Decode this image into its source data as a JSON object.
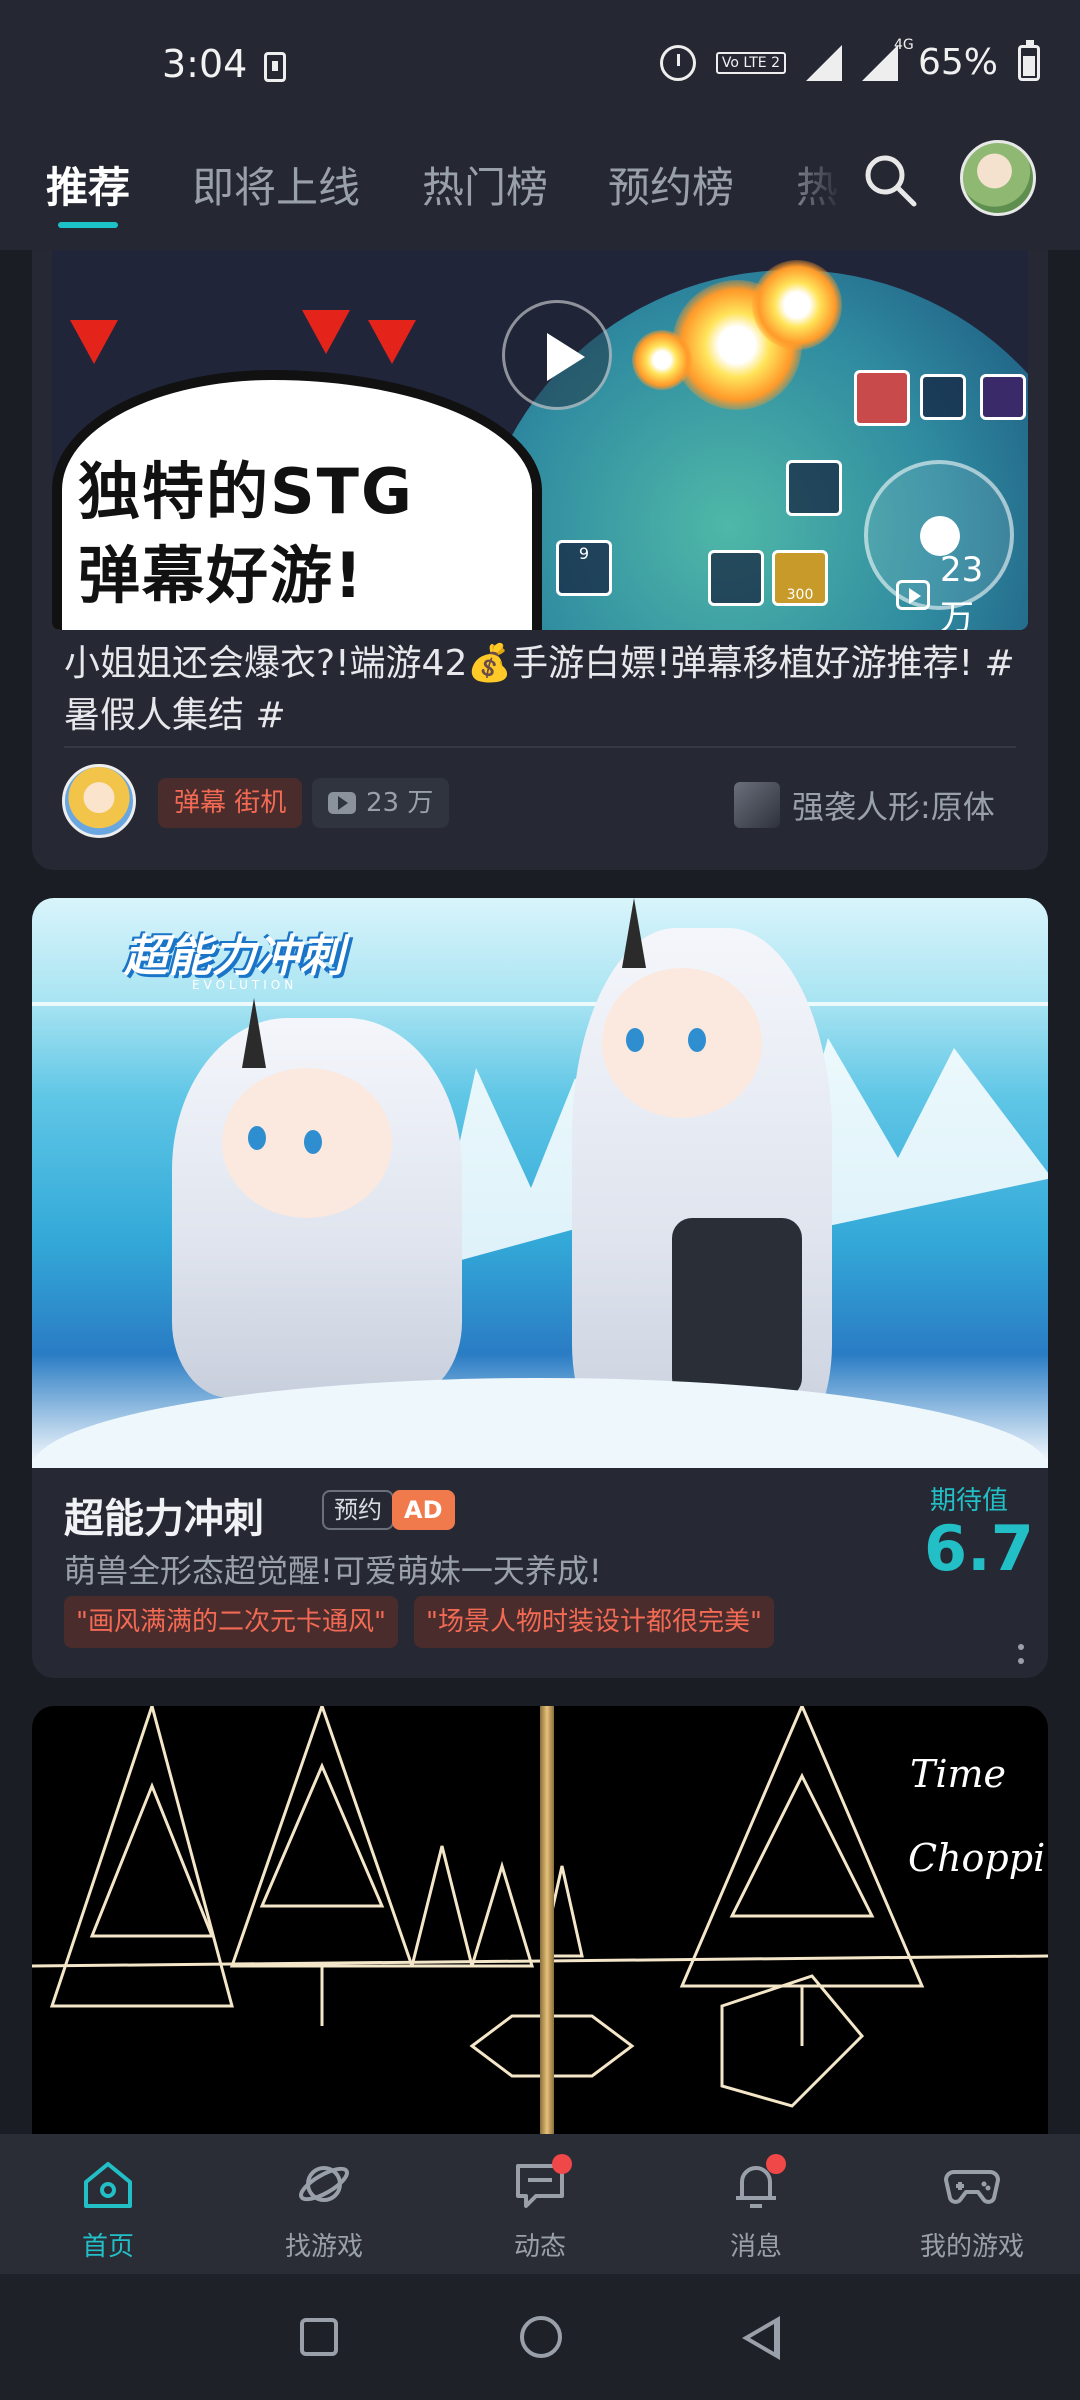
{
  "status_bar": {
    "time": "3:04",
    "volte_label": "Vo LTE 2",
    "network_label": "4G",
    "battery": "65%"
  },
  "top_tabs": [
    {
      "label": "推荐",
      "active": true
    },
    {
      "label": "即将上线",
      "active": false
    },
    {
      "label": "热门榜",
      "active": false
    },
    {
      "label": "预约榜",
      "active": false
    },
    {
      "label": "热",
      "active": false
    }
  ],
  "card1": {
    "banner_caption": "独特的STG\n弹幕好游!",
    "views_overlay": "23 万",
    "title": "小姐姐还会爆衣?!端游42💰手游白嫖!弹幕移植好游推荐! # 暑假人集结 #",
    "tag": "弹幕 街机",
    "views": "23 万",
    "game_ref": "强袭人形:原体",
    "skill_counts": [
      "9",
      "300"
    ]
  },
  "card2": {
    "logo": "超能力冲刺",
    "logo_sub": "EVOLUTION",
    "title": "超能力冲刺",
    "badge_reserve": "预约",
    "badge_ad": "AD",
    "expect_label": "期待值",
    "expect_value": "6.7",
    "description": "萌兽全形态超觉醒!可爱萌妹一天养成!",
    "quote_tags": [
      "\"画风满满的二次元卡通风\"",
      "\"场景人物时装设计都很完美\""
    ]
  },
  "card3": {
    "line1": "Time",
    "line2": "Chopping"
  },
  "bottom_nav": [
    {
      "label": "首页",
      "icon": "home-icon",
      "active": true,
      "badge": false
    },
    {
      "label": "找游戏",
      "icon": "planet-icon",
      "active": false,
      "badge": false
    },
    {
      "label": "动态",
      "icon": "chat-icon",
      "active": false,
      "badge": true
    },
    {
      "label": "消息",
      "icon": "bell-icon",
      "active": false,
      "badge": true
    },
    {
      "label": "我的游戏",
      "icon": "gamepad-icon",
      "active": false,
      "badge": false
    }
  ],
  "colors": {
    "accent": "#23bfc6",
    "background": "#1b1d24",
    "card": "#262933",
    "tag_red": "#f26a54",
    "ad_orange": "#f07a4c"
  }
}
